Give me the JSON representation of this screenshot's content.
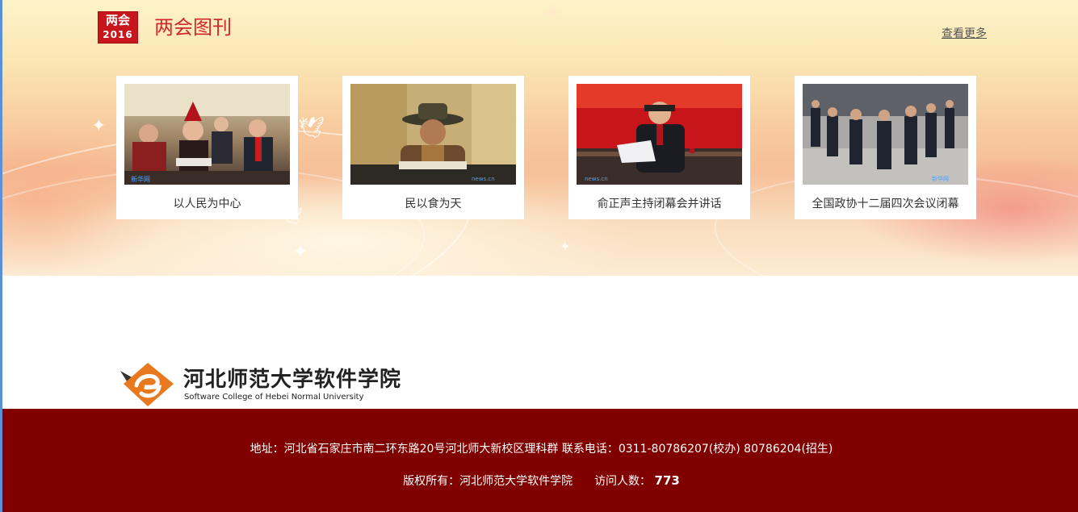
{
  "header": {
    "badge_top": "两会",
    "badge_year": "2016",
    "title": "两会图刊",
    "more_label": "查看更多"
  },
  "cards": [
    {
      "caption": "以人民为中心"
    },
    {
      "caption": "民以食为天"
    },
    {
      "caption": "俞正声主持闭幕会并讲话"
    },
    {
      "caption": "全国政协十二届四次会议闭幕"
    }
  ],
  "school": {
    "name_cn": "河北师范大学软件学院",
    "name_en": "Software College of Hebei Normal University"
  },
  "footer": {
    "address_line": "地址：河北省石家庄市南二环东路20号河北师大新校区理科群 联系电话：0311-80786207(校办) 80786204(招生)",
    "copyright_label": "版权所有：河北师范大学软件学院",
    "visitor_label": "访问人数：",
    "visitor_count": "773"
  },
  "colors": {
    "title_red": "#d0282b",
    "footer_bg": "#800000",
    "logo_orange": "#e8791e"
  }
}
